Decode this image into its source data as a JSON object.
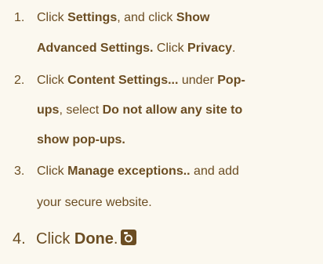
{
  "steps": [
    {
      "number": "1.",
      "lines": [
        [
          {
            "text": "Click ",
            "bold": false
          },
          {
            "text": "Settings",
            "bold": true
          },
          {
            "text": ", and click ",
            "bold": false
          },
          {
            "text": "Show",
            "bold": true
          }
        ],
        [
          {
            "text": "Advanced Settings.",
            "bold": true
          },
          {
            "text": " Click ",
            "bold": false
          },
          {
            "text": "Privacy",
            "bold": true
          },
          {
            "text": ".",
            "bold": false
          }
        ]
      ]
    },
    {
      "number": "2.",
      "lines": [
        [
          {
            "text": "Click ",
            "bold": false
          },
          {
            "text": "Content Settings...",
            "bold": true
          },
          {
            "text": " under ",
            "bold": false
          },
          {
            "text": "Pop-",
            "bold": true
          }
        ],
        [
          {
            "text": "ups",
            "bold": true
          },
          {
            "text": ", select ",
            "bold": false
          },
          {
            "text": "Do not allow any site to",
            "bold": true
          }
        ],
        [
          {
            "text": "show pop-ups.",
            "bold": true
          }
        ]
      ]
    },
    {
      "number": "3.",
      "lines": [
        [
          {
            "text": "Click ",
            "bold": false
          },
          {
            "text": "Manage exceptions..",
            "bold": true
          },
          {
            "text": " and add",
            "bold": false
          }
        ],
        [
          {
            "text": "your secure website.",
            "bold": false
          }
        ]
      ]
    },
    {
      "number": "4.",
      "lines": [
        [
          {
            "text": "Click ",
            "bold": false
          },
          {
            "text": "Done",
            "bold": true
          },
          {
            "text": ".",
            "bold": false
          }
        ]
      ],
      "icon": "camera-icon"
    }
  ],
  "colors": {
    "background": "#fbf8ef",
    "text": "#6b4d22",
    "icon": "#6b4d22"
  }
}
